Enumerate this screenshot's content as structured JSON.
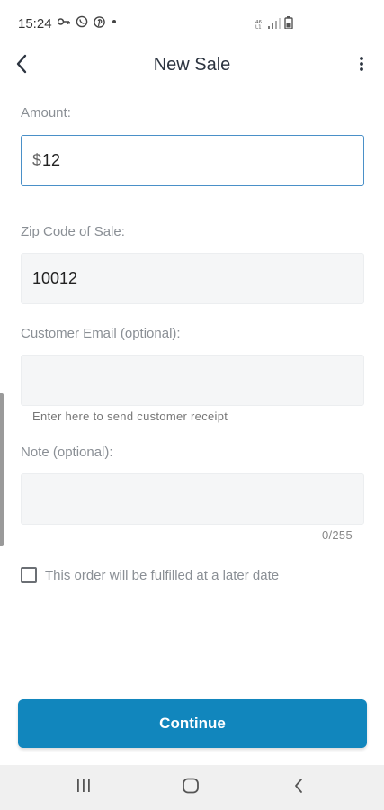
{
  "status_bar": {
    "time": "15:24",
    "left_icons": [
      "key-icon",
      "viber-icon",
      "pinterest-icon",
      "dot-icon"
    ],
    "right_icons": [
      "volte-icon",
      "signal-icon",
      "battery-icon"
    ]
  },
  "header": {
    "title": "New Sale",
    "back_icon": "chevron-left-icon",
    "menu_icon": "more-vert-icon"
  },
  "form": {
    "amount": {
      "label": "Amount:",
      "prefix": "$",
      "value": "12"
    },
    "zip": {
      "label": "Zip Code of Sale:",
      "value": "10012"
    },
    "email": {
      "label": "Customer Email (optional):",
      "value": "",
      "helper": "Enter here to send customer receipt"
    },
    "note": {
      "label": "Note (optional):",
      "value": "",
      "counter": "0/255"
    },
    "fulfill_later": {
      "label": "This order will be fulfilled at a later date",
      "checked": false
    }
  },
  "actions": {
    "continue_label": "Continue",
    "accent_color": "#1186bd"
  },
  "nav_bar": {
    "buttons": [
      "recents-icon",
      "home-icon",
      "back-icon"
    ]
  }
}
